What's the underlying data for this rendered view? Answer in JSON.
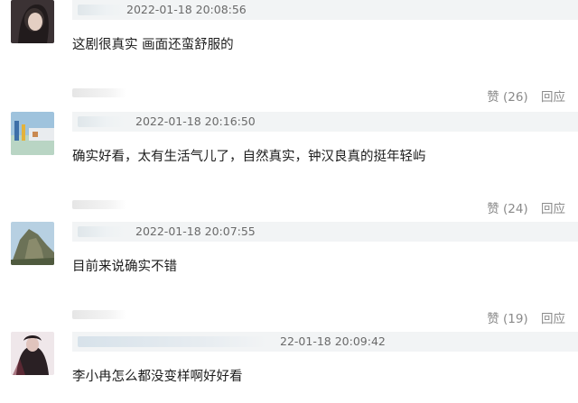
{
  "comments": [
    {
      "timestamp": "2022-01-18 20:08:56",
      "text": "这剧很真实 画面还蛮舒服的",
      "like_label": "赞 (26)",
      "reply_label": "回应"
    },
    {
      "timestamp": "2022-01-18 20:16:50",
      "text": "确实好看，太有生活气儿了，自然真实，钟汉良真的挺年轻屿",
      "like_label": "赞 (24)",
      "reply_label": "回应"
    },
    {
      "timestamp": "2022-01-18 20:07:55",
      "text": "目前来说确实不错",
      "like_label": "赞 (19)",
      "reply_label": "回应"
    },
    {
      "timestamp": "22-01-18 20:09:42",
      "text": "李小冉怎么都没变样啊好好看",
      "like_label": "",
      "reply_label": ""
    }
  ],
  "colors": {
    "meta_bar": "#f2f4f5",
    "timestamp": "#6a6a6a",
    "action_text": "#8a8a8a"
  }
}
